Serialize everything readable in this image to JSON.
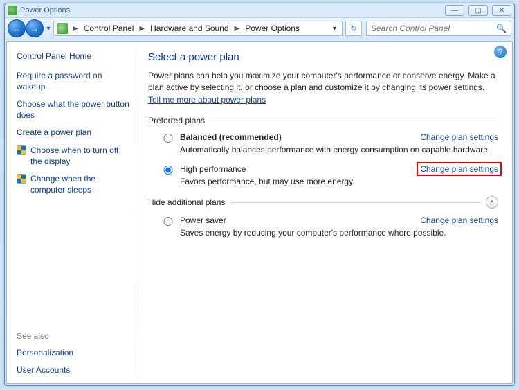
{
  "window": {
    "title": "Power Options"
  },
  "breadcrumb": {
    "items": [
      "Control Panel",
      "Hardware and Sound",
      "Power Options"
    ]
  },
  "search": {
    "placeholder": "Search Control Panel"
  },
  "sidebar": {
    "home": "Control Panel Home",
    "links": [
      "Require a password on wakeup",
      "Choose what the power button does",
      "Create a power plan",
      "Choose when to turn off the display",
      "Change when the computer sleeps"
    ],
    "see_also_label": "See also",
    "see_also": [
      "Personalization",
      "User Accounts"
    ]
  },
  "main": {
    "heading": "Select a power plan",
    "description_prefix": "Power plans can help you maximize your computer's performance or conserve energy. Make a plan active by selecting it, or choose a plan and customize it by changing its power settings. ",
    "learn_more": "Tell me more about power plans",
    "preferred_label": "Preferred plans",
    "hide_label": "Hide additional plans",
    "change_link": "Change plan settings",
    "plans": {
      "balanced": {
        "title": "Balanced (recommended)",
        "desc": "Automatically balances performance with energy consumption on capable hardware."
      },
      "high_perf": {
        "title": "High performance",
        "desc": "Favors performance, but may use more energy."
      },
      "power_saver": {
        "title": "Power saver",
        "desc": "Saves energy by reducing your computer's performance where possible."
      }
    }
  }
}
